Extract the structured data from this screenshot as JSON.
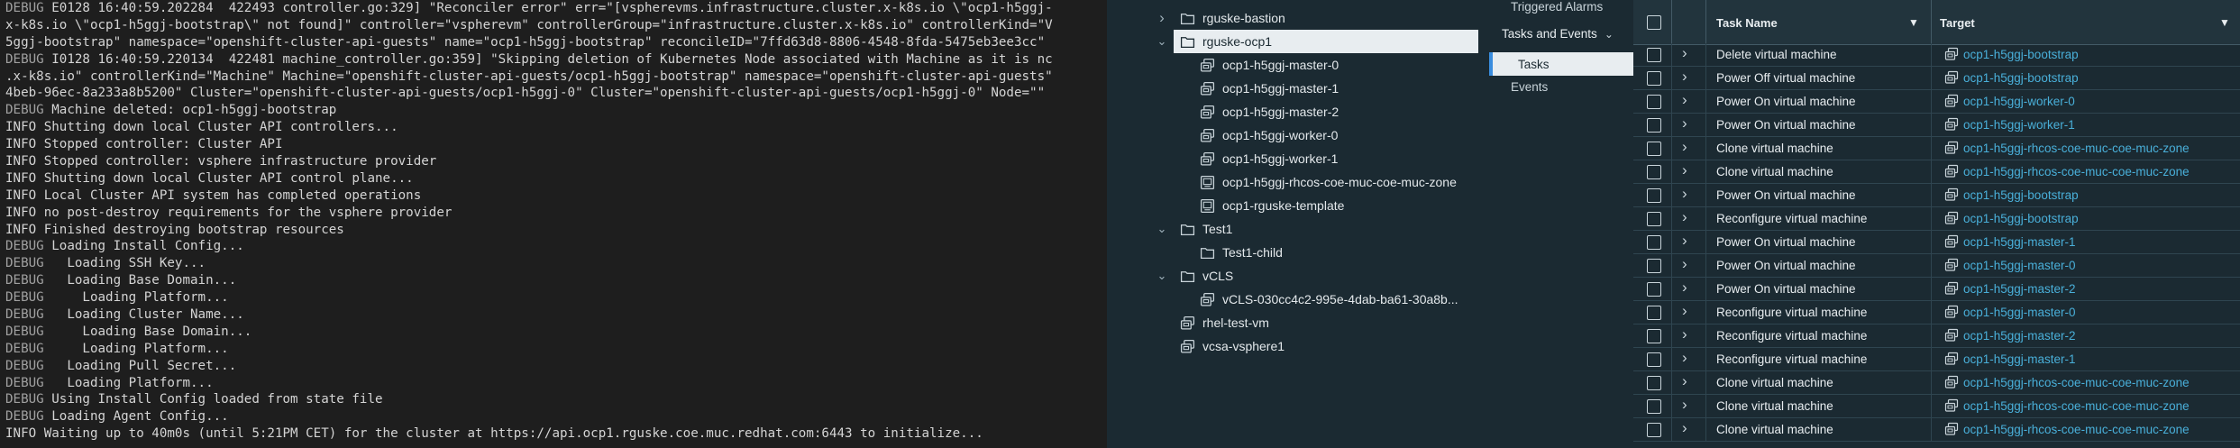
{
  "terminal": {
    "lines": [
      {
        "level": "DEBUG",
        "text": " E0128 16:40:59.202284  422493 controller.go:329] \"Reconciler error\" err=\"[vspherevms.infrastructure.cluster.x-k8s.io \\\"ocp1-h5ggj-"
      },
      {
        "level": "",
        "text": "x-k8s.io \\\"ocp1-h5ggj-bootstrap\\\" not found]\" controller=\"vspherevm\" controllerGroup=\"infrastructure.cluster.x-k8s.io\" controllerKind=\"V"
      },
      {
        "level": "",
        "text": "5ggj-bootstrap\" namespace=\"openshift-cluster-api-guests\" name=\"ocp1-h5ggj-bootstrap\" reconcileID=\"7ffd63d8-8806-4548-8fda-5475eb3ee3cc\""
      },
      {
        "level": "DEBUG",
        "text": " I0128 16:40:59.220134  422481 machine_controller.go:359] \"Skipping deletion of Kubernetes Node associated with Machine as it is nc"
      },
      {
        "level": "",
        "text": ".x-k8s.io\" controllerKind=\"Machine\" Machine=\"openshift-cluster-api-guests/ocp1-h5ggj-bootstrap\" namespace=\"openshift-cluster-api-guests\""
      },
      {
        "level": "",
        "text": "4beb-96ec-8a233a8b5200\" Cluster=\"openshift-cluster-api-guests/ocp1-h5ggj-0\" Cluster=\"openshift-cluster-api-guests/ocp1-h5ggj-0\" Node=\"\""
      },
      {
        "level": "DEBUG",
        "text": " Machine deleted: ocp1-h5ggj-bootstrap"
      },
      {
        "level": "INFO",
        "text": " Shutting down local Cluster API controllers..."
      },
      {
        "level": "INFO",
        "text": " Stopped controller: Cluster API"
      },
      {
        "level": "INFO",
        "text": " Stopped controller: vsphere infrastructure provider"
      },
      {
        "level": "INFO",
        "text": " Shutting down local Cluster API control plane..."
      },
      {
        "level": "INFO",
        "text": " Local Cluster API system has completed operations"
      },
      {
        "level": "INFO",
        "text": " no post-destroy requirements for the vsphere provider"
      },
      {
        "level": "INFO",
        "text": " Finished destroying bootstrap resources"
      },
      {
        "level": "DEBUG",
        "text": " Loading Install Config..."
      },
      {
        "level": "DEBUG",
        "text": "   Loading SSH Key..."
      },
      {
        "level": "DEBUG",
        "text": "   Loading Base Domain..."
      },
      {
        "level": "DEBUG",
        "text": "     Loading Platform..."
      },
      {
        "level": "DEBUG",
        "text": "   Loading Cluster Name..."
      },
      {
        "level": "DEBUG",
        "text": "     Loading Base Domain..."
      },
      {
        "level": "DEBUG",
        "text": "     Loading Platform..."
      },
      {
        "level": "DEBUG",
        "text": "   Loading Pull Secret..."
      },
      {
        "level": "DEBUG",
        "text": "   Loading Platform..."
      },
      {
        "level": "DEBUG",
        "text": " Using Install Config loaded from state file"
      },
      {
        "level": "DEBUG",
        "text": " Loading Agent Config..."
      },
      {
        "level": "INFO",
        "text": " Waiting up to 40m0s (until 5:21PM CET) for the cluster at https://api.ocp1.rguske.coe.muc.redhat.com:6443 to initialize..."
      }
    ]
  },
  "inventory": {
    "items": [
      {
        "label": "rguske-bastion",
        "icon": "folder-icon",
        "chevron": "right",
        "selected": false
      },
      {
        "label": "rguske-ocp1",
        "icon": "folder-icon",
        "chevron": "down",
        "selected": true
      },
      {
        "label": "ocp1-h5ggj-master-0",
        "icon": "vm-icon",
        "chevron": "",
        "selected": false
      },
      {
        "label": "ocp1-h5ggj-master-1",
        "icon": "vm-icon",
        "chevron": "",
        "selected": false
      },
      {
        "label": "ocp1-h5ggj-master-2",
        "icon": "vm-icon",
        "chevron": "",
        "selected": false
      },
      {
        "label": "ocp1-h5ggj-worker-0",
        "icon": "vm-icon",
        "chevron": "",
        "selected": false
      },
      {
        "label": "ocp1-h5ggj-worker-1",
        "icon": "vm-icon",
        "chevron": "",
        "selected": false
      },
      {
        "label": "ocp1-h5ggj-rhcos-coe-muc-coe-muc-zone",
        "icon": "vm-template-icon",
        "chevron": "",
        "selected": false
      },
      {
        "label": "ocp1-rguske-template",
        "icon": "vm-template-icon",
        "chevron": "",
        "selected": false
      },
      {
        "label": "Test1",
        "icon": "folder-icon",
        "chevron": "down",
        "selected": false
      },
      {
        "label": "Test1-child",
        "icon": "folder-icon",
        "chevron": "",
        "selected": false
      },
      {
        "label": "vCLS",
        "icon": "folder-icon",
        "chevron": "down",
        "selected": false
      },
      {
        "label": "vCLS-030cc4c2-995e-4dab-ba61-30a8b...",
        "icon": "vm-icon",
        "chevron": "",
        "selected": false
      },
      {
        "label": "rhel-test-vm",
        "icon": "vm-icon",
        "chevron": "",
        "selected": false
      },
      {
        "label": "vcsa-vsphere1",
        "icon": "vm-icon",
        "chevron": "",
        "selected": false
      }
    ]
  },
  "monitor_nav": {
    "alarms": "Triggered Alarms",
    "group": "Tasks and Events",
    "tasks": "Tasks",
    "events": "Events"
  },
  "tasks_grid": {
    "header": {
      "task_name": "Task Name",
      "target": "Target"
    },
    "rows": [
      {
        "task": "Delete virtual machine",
        "target": "ocp1-h5ggj-bootstrap"
      },
      {
        "task": "Power Off virtual machine",
        "target": "ocp1-h5ggj-bootstrap"
      },
      {
        "task": "Power On virtual machine",
        "target": "ocp1-h5ggj-worker-0"
      },
      {
        "task": "Power On virtual machine",
        "target": "ocp1-h5ggj-worker-1"
      },
      {
        "task": "Clone virtual machine",
        "target": "ocp1-h5ggj-rhcos-coe-muc-coe-muc-zone"
      },
      {
        "task": "Clone virtual machine",
        "target": "ocp1-h5ggj-rhcos-coe-muc-coe-muc-zone"
      },
      {
        "task": "Power On virtual machine",
        "target": "ocp1-h5ggj-bootstrap"
      },
      {
        "task": "Reconfigure virtual machine",
        "target": "ocp1-h5ggj-bootstrap"
      },
      {
        "task": "Power On virtual machine",
        "target": "ocp1-h5ggj-master-1"
      },
      {
        "task": "Power On virtual machine",
        "target": "ocp1-h5ggj-master-0"
      },
      {
        "task": "Power On virtual machine",
        "target": "ocp1-h5ggj-master-2"
      },
      {
        "task": "Reconfigure virtual machine",
        "target": "ocp1-h5ggj-master-0"
      },
      {
        "task": "Reconfigure virtual machine",
        "target": "ocp1-h5ggj-master-2"
      },
      {
        "task": "Reconfigure virtual machine",
        "target": "ocp1-h5ggj-master-1"
      },
      {
        "task": "Clone virtual machine",
        "target": "ocp1-h5ggj-rhcos-coe-muc-coe-muc-zone"
      },
      {
        "task": "Clone virtual machine",
        "target": "ocp1-h5ggj-rhcos-coe-muc-coe-muc-zone"
      },
      {
        "task": "Clone virtual machine",
        "target": "ocp1-h5ggj-rhcos-coe-muc-coe-muc-zone"
      }
    ]
  },
  "colors": {
    "terminal_bg": "#1e1e1e",
    "panel_bg": "#1b2a32",
    "link": "#49afd9",
    "selection_bg": "#e8edf0",
    "accent": "#3a8dde"
  }
}
